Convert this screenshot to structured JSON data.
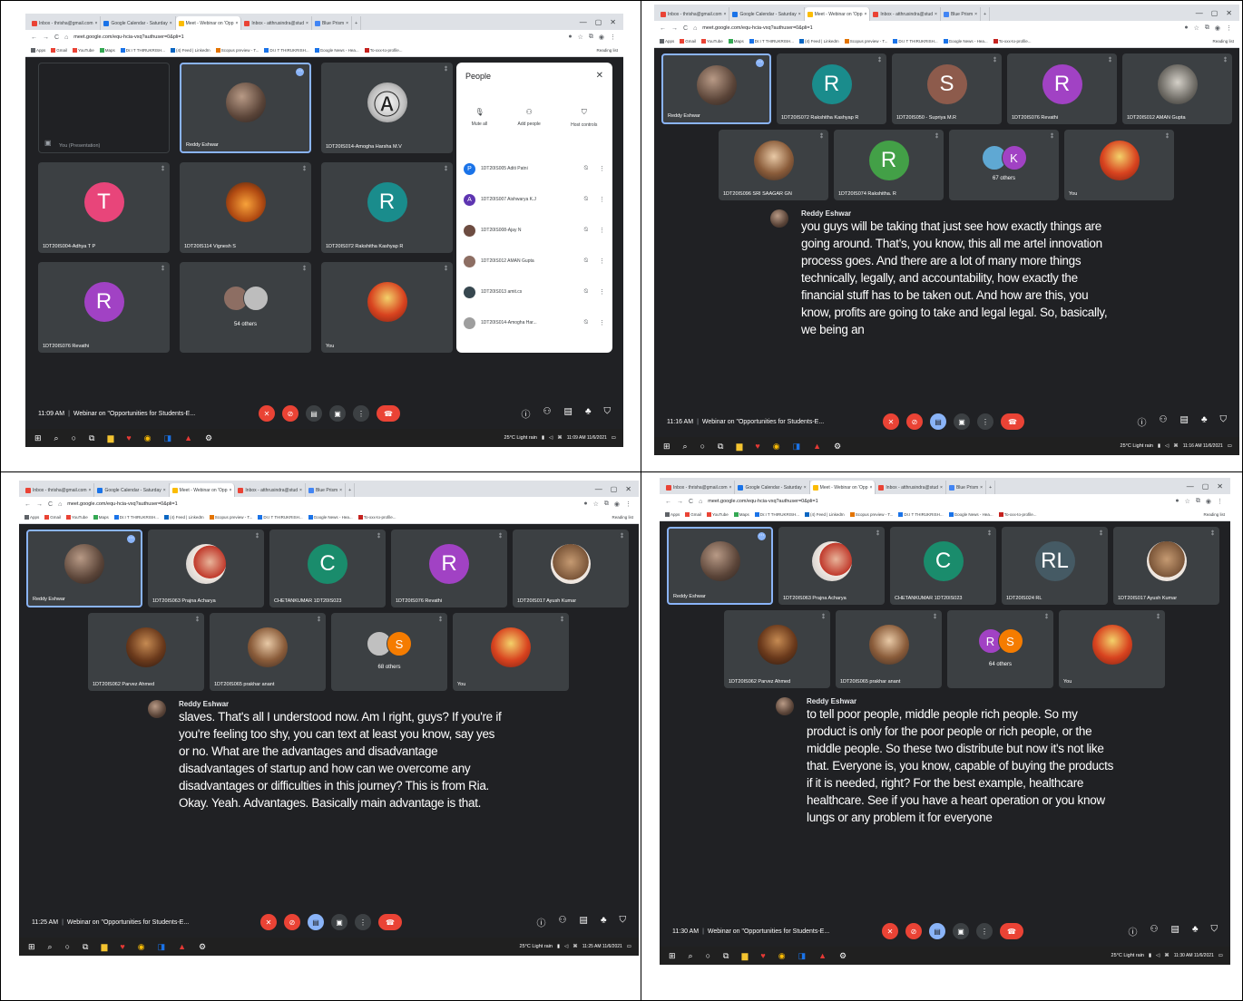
{
  "browser": {
    "tabs": [
      "Inbox - thrisha@gmail.com",
      "Google Calendar - Saturday",
      "Meet - Webinar on 'Opp",
      "Inbox - atthrusindra@stud",
      "Blue Prism"
    ],
    "url": "meet.google.com/equ-hcia-vxq?authuser=0&pli=1",
    "bookmarks": [
      "Apps",
      "Gmail",
      "YouTube",
      "Maps",
      "Dr.I T THIRUKRISH...",
      "(4) Feed | LinkedIn",
      "Scopus preview - T...",
      "Dr.I T THIRUKRISH...",
      "Google News - Hea...",
      "To-xxx-to-profile..."
    ],
    "reading_list": "Reading list"
  },
  "screens": [
    {
      "time": "11:09 AM",
      "meeting_title": "Webinar on \"Opportunities for Students-E...",
      "tiles": [
        {
          "name": "You (Presentation)",
          "kind": "presentation"
        },
        {
          "name": "Reddy Eshwar",
          "kind": "photo",
          "active": true
        },
        {
          "name": "1DT20IS014-Amogha Harsha M.V",
          "kind": "avenger"
        },
        {
          "name": "1DT20IS004-Adhya T P",
          "initial": "T",
          "color": "#e8457a"
        },
        {
          "name": "1DT20IS114 Vignesh S",
          "kind": "fire"
        },
        {
          "name": "1DT20IS072 Rakshitha Kashyap R",
          "initial": "R",
          "color": "#1a8c8c"
        },
        {
          "name": "1DT20IS076 Revathi",
          "initial": "R",
          "color": "#a142c4"
        },
        {
          "name": "",
          "others": "54 others"
        },
        {
          "name": "You",
          "kind": "photo3"
        }
      ],
      "people_panel": {
        "title": "People",
        "actions": [
          "Mute all",
          "Add people",
          "Host controls"
        ],
        "list": [
          {
            "name": "1DT20IS005 Aditi Patni",
            "initial": "P",
            "color": "#1a73e8"
          },
          {
            "name": "1DT20IS007 Aishwarya K.J",
            "initial": "A",
            "color": "#5e35b1"
          },
          {
            "name": "1DT20IS008-Ajay N",
            "initial": "",
            "color": "#6d4c41"
          },
          {
            "name": "1DT20IS012 AMAN Gupta",
            "initial": "",
            "color": "#8d6e63"
          },
          {
            "name": "1DT20IS013 amit.cs",
            "initial": "",
            "color": "#37474f"
          },
          {
            "name": "1DT20IS014-Amogha Har...",
            "initial": "",
            "color": "#9e9e9e"
          }
        ]
      }
    },
    {
      "time": "11:16 AM",
      "meeting_title": "Webinar on \"Opportunities for Students-E...",
      "tiles": [
        {
          "name": "Reddy Eshwar",
          "kind": "photo",
          "active": true
        },
        {
          "name": "1DT20IS072 Rakshitha Kashyap R",
          "initial": "R",
          "color": "#1a8c8c"
        },
        {
          "name": "1DT20IS050 - Supriya M.R",
          "initial": "S",
          "color": "#8d5b4c"
        },
        {
          "name": "1DT20IS076 Revathi",
          "initial": "R",
          "color": "#a142c4"
        },
        {
          "name": "1DT20IS012 AMAN Gupta",
          "kind": "photo5"
        },
        {
          "name": "1DT20IS096 SRI SAAGAR GN",
          "kind": "photo2"
        },
        {
          "name": "1DT20IS074 Rakshitha. R",
          "initial": "R",
          "color": "#43a047"
        },
        {
          "name": "",
          "others": "67 others",
          "group": [
            "#5fa8d3",
            "#a142c4"
          ],
          "ginit": [
            "",
            "K"
          ]
        },
        {
          "name": "You",
          "kind": "photo3"
        }
      ],
      "caption": {
        "speaker": "Reddy Eshwar",
        "text": "you guys will be taking that just see how exactly things are going around. That's, you know, this all me artel innovation process goes. And there are a lot of many more things technically, legally, and accountability, how exactly the financial stuff has to be taken out. And how are this, you know, profits are going to take and legal legal. So, basically, we being an"
      }
    },
    {
      "time": "11:25 AM",
      "meeting_title": "Webinar on \"Opportunities for Students-E...",
      "tiles": [
        {
          "name": "Reddy Eshwar",
          "kind": "photo",
          "active": true
        },
        {
          "name": "1DT20IS063 Prajna Acharya",
          "kind": "photo6"
        },
        {
          "name": "CHETANKUMAR 1DT20IS023",
          "initial": "C",
          "color": "#1a8c6c"
        },
        {
          "name": "1DT20IS076 Revathi",
          "initial": "R",
          "color": "#a142c4"
        },
        {
          "name": "1DT20IS017 Ayush Kumar",
          "kind": "photo7"
        },
        {
          "name": "1DT20IS062 Parvez Ahmed",
          "kind": "photo4"
        },
        {
          "name": "1DT20IS065 prakhar anant",
          "kind": "photo2"
        },
        {
          "name": "",
          "others": "68 others",
          "group": [
            "#c0c0c0",
            "#f57c00"
          ],
          "ginit": [
            "",
            "S"
          ]
        },
        {
          "name": "You",
          "kind": "photo3"
        }
      ],
      "caption": {
        "speaker": "Reddy Eshwar",
        "text": "slaves. That's all I understood now. Am I right, guys? If you're if you're feeling too shy, you can text at least you know, say yes or no. What are the advantages and disadvantage disadvantages of startup and how can we overcome any disadvantages or difficulties in this journey? This is from Ria. Okay. Yeah. Advantages. Basically main advantage is that."
      }
    },
    {
      "time": "11:30 AM",
      "meeting_title": "Webinar on \"Opportunities for Students-E...",
      "tiles": [
        {
          "name": "Reddy Eshwar",
          "kind": "photo",
          "active": true
        },
        {
          "name": "1DT20IS063 Prajna Acharya",
          "kind": "photo6"
        },
        {
          "name": "CHETANKUMAR 1DT20IS023",
          "initial": "C",
          "color": "#1a8c6c"
        },
        {
          "name": "1DT20IS024 RL",
          "initial": "RL",
          "color": "#455a64"
        },
        {
          "name": "1DT20IS017 Ayush Kumar",
          "kind": "photo7"
        },
        {
          "name": "1DT20IS062 Parvez Ahmed",
          "kind": "photo4"
        },
        {
          "name": "1DT20IS065 prakhar anant",
          "kind": "photo2"
        },
        {
          "name": "",
          "others": "64 others",
          "group": [
            "#a142c4",
            "#f57c00"
          ],
          "ginit": [
            "R",
            "S"
          ]
        },
        {
          "name": "You",
          "kind": "photo3"
        }
      ],
      "caption": {
        "speaker": "Reddy Eshwar",
        "text": "to tell poor people, middle people rich people. So my product is only for the poor people or rich people, or the middle people. So these two distribute but now it's not like that. Everyone is, you know, capable of buying the products if it is needed, right? For the best example, healthcare healthcare. See if you have a heart operation or you know lungs or any problem it for everyone"
      }
    }
  ],
  "taskbar": {
    "weather": "25°C Light rain",
    "dates": [
      "11:09 AM 11/6/2021",
      "11:16 AM 11/6/2021",
      "11:25 AM 11/6/2021",
      "11:30 AM 11/6/2021"
    ]
  }
}
